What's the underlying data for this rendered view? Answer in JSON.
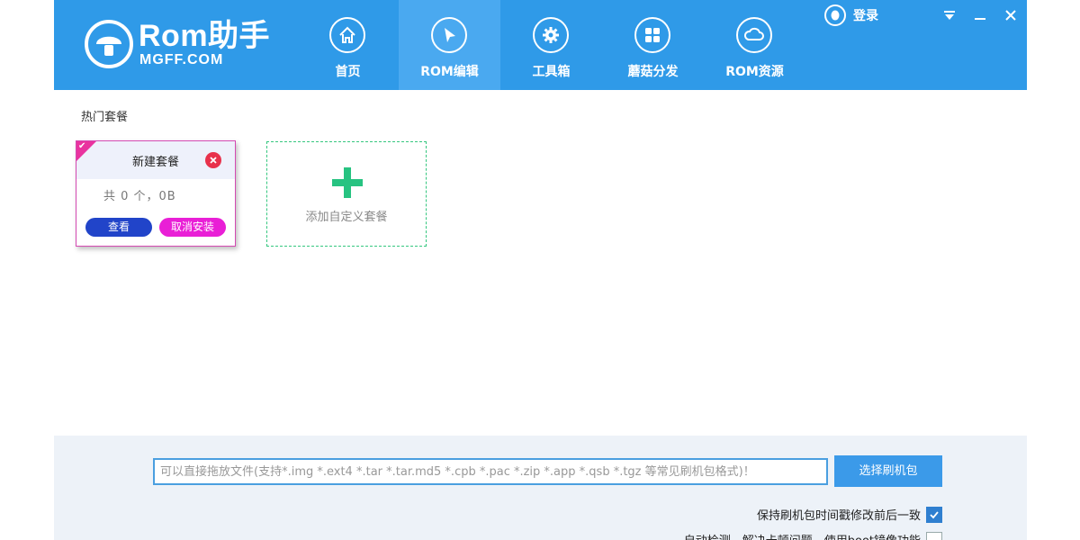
{
  "brand": {
    "name": "Rom助手",
    "sub": "MGFF.COM"
  },
  "nav": {
    "items": [
      {
        "label": "首页",
        "icon": "home-icon"
      },
      {
        "label": "ROM编辑",
        "icon": "cursor-icon",
        "active": true
      },
      {
        "label": "工具箱",
        "icon": "gear-icon"
      },
      {
        "label": "蘑菇分发",
        "icon": "grid-icon"
      },
      {
        "label": "ROM资源",
        "icon": "cloud-icon"
      }
    ]
  },
  "header": {
    "login_label": "登录"
  },
  "colors": {
    "header": "#2f9ae8",
    "accent": "#3b9ae9",
    "card_border": "#d44ab2",
    "add_border": "#35c77f"
  },
  "main": {
    "section_title": "热门套餐",
    "card": {
      "title": "新建套餐",
      "info": "共  0 个，0B",
      "view_label": "查看",
      "cancel_label": "取消安装"
    },
    "add_card": {
      "label": "添加自定义套餐"
    }
  },
  "bottom": {
    "drop_placeholder": "可以直接拖放文件(支持*.img *.ext4 *.tar *.tar.md5 *.cpb *.pac *.zip *.app *.qsb *.tgz 等常见刷机包格式)！",
    "select_label": "选择刷机包",
    "option1_label": "保持刷机包时间戳修改前后一致",
    "option1_checked": true,
    "option2_label": "自动检测、解决卡顿问题，使用boot镜像功能",
    "option2_checked": false
  }
}
